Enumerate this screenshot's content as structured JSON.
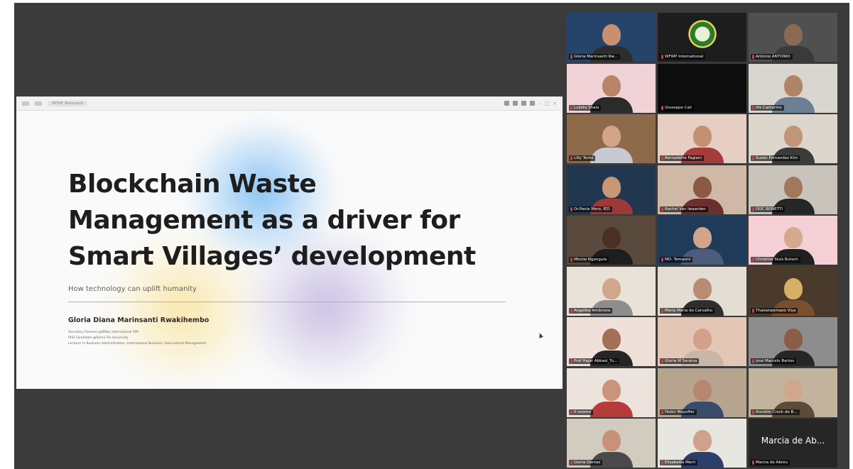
{
  "slide": {
    "toolbar_tab": "WFWP_Merinsanti",
    "title_lines": [
      "Blockchain Waste",
      "Management as a driver for",
      "Smart Villages’ development"
    ],
    "subtitle": "How technology can uplift humanity",
    "author": "Gloria Diana Marinsanti Rwakihembo",
    "affiliations": [
      "Secretary General @Wfwp international SPA",
      "PhD Candidate @Roma Tre University",
      "Lecturer in Business Administration, International Business, Intercultural Management"
    ]
  },
  "participants": [
    {
      "name": "Gloria Marinsanti Rw...",
      "active": true,
      "bg": "#26436a",
      "skin": "#c9906e",
      "shirt": "#2d2d2d"
    },
    {
      "name": "WFWP International",
      "logo": true,
      "bg": "#1d1d1d"
    },
    {
      "name": "Antonio ANTONIO",
      "bg": "#505050",
      "skin": "#8a6a55",
      "shirt": "#3a3a3a"
    },
    {
      "name": "Luljeta Shala",
      "bg": "#f1d3d7",
      "skin": "#b98468",
      "shirt": "#2b2b2b"
    },
    {
      "name": "Giuseppe Cali",
      "bg": "#0d0d0d"
    },
    {
      "name": "Iris Camarino",
      "bg": "#d9d6cf",
      "skin": "#b08566",
      "shirt": "#6c7f94"
    },
    {
      "name": "Lilly Tarini",
      "bg": "#8d6b4a",
      "skin": "#d3a588",
      "shirt": "#c9c9d3"
    },
    {
      "name": "Bernadette Fagiani",
      "bg": "#e6cfc2",
      "skin": "#c58f73",
      "shirt": "#a33d3d"
    },
    {
      "name": "Suzan Fernandez Kim",
      "bg": "#dcd6cc",
      "skin": "#c29577",
      "shirt": "#3b3b3b"
    },
    {
      "name": "Dr.Paola Moro, IED",
      "bg": "#20374f",
      "skin": "#c79776",
      "shirt": "#9c3a3a"
    },
    {
      "name": "Rachel Van Iwaarden",
      "bg": "#cfb8a5",
      "skin": "#8c5a43",
      "shirt": "#6a2f2f"
    },
    {
      "name": "DOC BONETTI",
      "bg": "#c9c4bb",
      "skin": "#a2775c",
      "shirt": "#262626"
    },
    {
      "name": "Minnie Ngangula",
      "bg": "#5a4a3d",
      "skin": "#4a3024",
      "shirt": "#1e1e1e"
    },
    {
      "name": "MD. Tomasini",
      "bg": "#203a5a",
      "skin": "#d1a58a",
      "shirt": "#4b5d7a"
    },
    {
      "name": "Christine Sluis Butsch",
      "bg": "#f4cfd6",
      "skin": "#d4a98f",
      "shirt": "#202020"
    },
    {
      "name": "Angelika Ambrosia",
      "bg": "#e9e2d8",
      "skin": "#d1a68b",
      "shirt": "#8d8d8d"
    },
    {
      "name": "Maria Maria de Carvalho",
      "bg": "#e3ddd3",
      "skin": "#b88b72",
      "shirt": "#2e2e2e"
    },
    {
      "name": "Thaiseiwemaeo Viya",
      "bg": "#4a3a2c",
      "skin": "#d7b066",
      "shirt": "#7b4e2e"
    },
    {
      "name": "Prof Hajar Abbasi_Tu...",
      "bg": "#efe0d9",
      "skin": "#a26f57",
      "shirt": "#262626"
    },
    {
      "name": "Gloria M Saraiva",
      "bg": "#e4c6b7",
      "skin": "#d3a08a",
      "shirt": "#c8b7a6"
    },
    {
      "name": "José Marcelo Bartos",
      "bg": "#8d8d8d",
      "skin": "#8a5d48",
      "shirt": "#262626"
    },
    {
      "name": "It zoomo",
      "bg": "#ece4dc",
      "skin": "#c99479",
      "shirt": "#b83b3b"
    },
    {
      "name": "Helen Mayoffer",
      "bg": "#b7a48e",
      "skin": "#b7866e",
      "shirt": "#394d6b"
    },
    {
      "name": "Annette Crock de B...",
      "bg": "#c2b39d",
      "skin": "#d0a68c",
      "shirt": "#5d4b3a"
    },
    {
      "name": "Gloria Damas",
      "bg": "#d2cbc0",
      "skin": "#c79277",
      "shirt": "#4a4a4a"
    },
    {
      "name": "Elisabetta Merri",
      "bg": "#e8e6e1",
      "skin": "#d1a28a",
      "shirt": "#2e3e6a"
    },
    {
      "name": "Marcia de Abreu",
      "big_name": "Marcia de Ab...",
      "bg": "#262626"
    }
  ]
}
